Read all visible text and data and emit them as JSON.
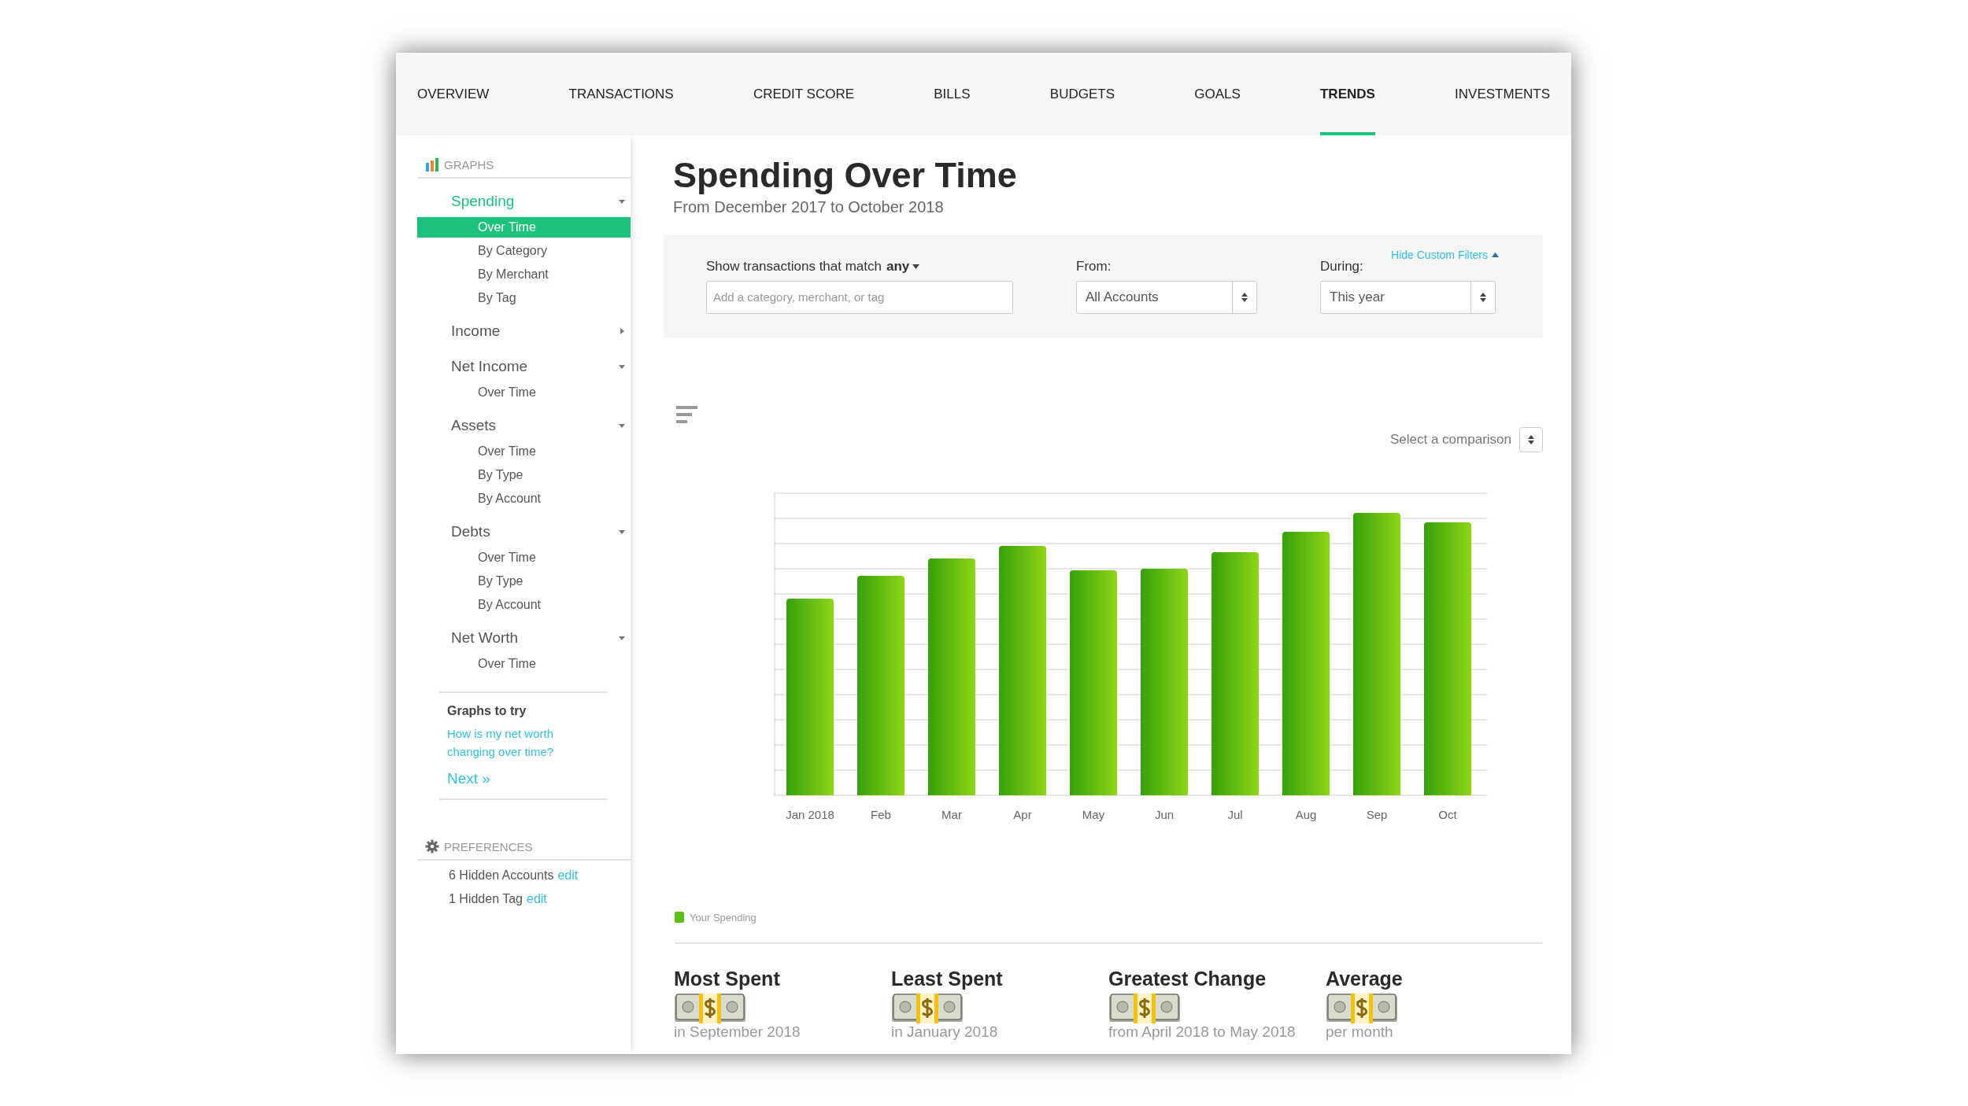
{
  "nav": [
    {
      "label": "OVERVIEW",
      "selected": false
    },
    {
      "label": "TRANSACTIONS",
      "selected": false
    },
    {
      "label": "CREDIT SCORE",
      "selected": false
    },
    {
      "label": "BILLS",
      "selected": false
    },
    {
      "label": "BUDGETS",
      "selected": false
    },
    {
      "label": "GOALS",
      "selected": false
    },
    {
      "label": "TRENDS",
      "selected": true
    },
    {
      "label": "INVESTMENTS",
      "selected": false
    }
  ],
  "sidebar": {
    "graphs_header": "GRAPHS",
    "groups": [
      {
        "label": "Spending",
        "active": true,
        "expanded": true,
        "children": [
          {
            "label": "Over Time",
            "selected": true
          },
          {
            "label": "By Category",
            "selected": false
          },
          {
            "label": "By Merchant",
            "selected": false
          },
          {
            "label": "By Tag",
            "selected": false
          }
        ]
      },
      {
        "label": "Income",
        "active": false,
        "expanded": false
      },
      {
        "label": "Net Income",
        "active": false,
        "expanded": true,
        "children": [
          {
            "label": "Over Time",
            "selected": false
          }
        ]
      },
      {
        "label": "Assets",
        "active": false,
        "expanded": true,
        "children": [
          {
            "label": "Over Time",
            "selected": false
          },
          {
            "label": "By Type",
            "selected": false
          },
          {
            "label": "By Account",
            "selected": false
          }
        ]
      },
      {
        "label": "Debts",
        "active": false,
        "expanded": true,
        "children": [
          {
            "label": "Over Time",
            "selected": false
          },
          {
            "label": "By Type",
            "selected": false
          },
          {
            "label": "By Account",
            "selected": false
          }
        ]
      },
      {
        "label": "Net Worth",
        "active": false,
        "expanded": true,
        "children": [
          {
            "label": "Over Time",
            "selected": false
          }
        ]
      }
    ],
    "graphs_to_try": {
      "heading": "Graphs to try",
      "link": "How is my net worth changing over time?",
      "next": "Next »"
    },
    "preferences": {
      "header": "PREFERENCES",
      "items": [
        {
          "text": "6 Hidden Accounts",
          "link": "edit"
        },
        {
          "text": "1 Hidden Tag",
          "link": "edit"
        }
      ]
    }
  },
  "main": {
    "title": "Spending Over Time",
    "subtitle": "From December 2017 to October 2018",
    "filters": {
      "hide_link": "Hide Custom Filters",
      "match_label": "Show transactions that match",
      "match_value": "any",
      "search_placeholder": "Add a category, merchant, or tag",
      "from_label": "From:",
      "from_value": "All Accounts",
      "during_label": "During:",
      "during_value": "This year"
    },
    "comparison": "Select a comparison",
    "chart": {
      "months": [
        "Jan 2018",
        "Feb",
        "Mar",
        "Apr",
        "May",
        "Jun",
        "Jul",
        "Aug",
        "Sep",
        "Oct"
      ],
      "legend": "Your Spending"
    },
    "stats": [
      {
        "heading": "Most Spent",
        "detail": "in September 2018"
      },
      {
        "heading": "Least Spent",
        "detail": "in January 2018"
      },
      {
        "heading": "Greatest Change",
        "detail": "from April 2018 to May 2018"
      },
      {
        "heading": "Average",
        "detail": "per month"
      }
    ]
  }
}
